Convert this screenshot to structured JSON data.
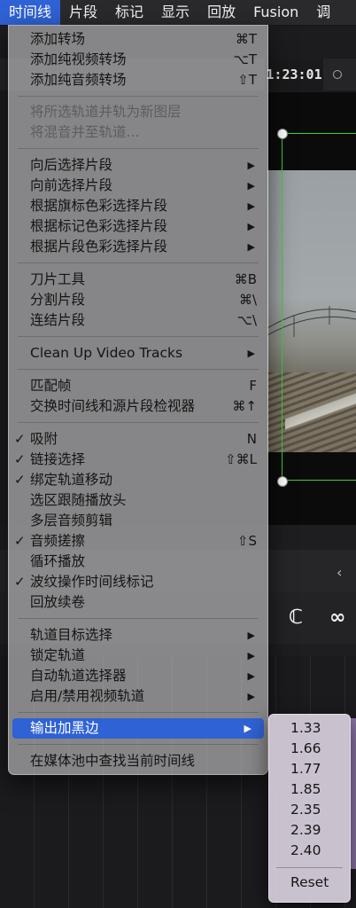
{
  "menubar": {
    "items": [
      "时间线",
      "片段",
      "标记",
      "显示",
      "回放",
      "Fusion",
      "调"
    ]
  },
  "viewer": {
    "timecode": "1:23:01"
  },
  "timeline_menu": {
    "items": [
      {
        "label": "添加转场",
        "shortcut": "⌘T"
      },
      {
        "label": "添加纯视频转场",
        "shortcut": "⌥T"
      },
      {
        "label": "添加纯音频转场",
        "shortcut": "⇧T"
      },
      {
        "label": "将所选轨道并轨为新图层",
        "shortcut": ""
      },
      {
        "label": "将混音并至轨道...",
        "shortcut": ""
      },
      {
        "label": "向后选择片段",
        "shortcut": ""
      },
      {
        "label": "向前选择片段",
        "shortcut": ""
      },
      {
        "label": "根据旗标色彩选择片段",
        "shortcut": ""
      },
      {
        "label": "根据标记色彩选择片段",
        "shortcut": ""
      },
      {
        "label": "根据片段色彩选择片段",
        "shortcut": ""
      },
      {
        "label": "刀片工具",
        "shortcut": "⌘B"
      },
      {
        "label": "分割片段",
        "shortcut": "⌘\\"
      },
      {
        "label": "连结片段",
        "shortcut": "⌥\\"
      },
      {
        "label": "Clean Up Video Tracks",
        "shortcut": ""
      },
      {
        "label": "匹配帧",
        "shortcut": "F"
      },
      {
        "label": "交换时间线和源片段检视器",
        "shortcut": "⌘↑"
      },
      {
        "label": "吸附",
        "shortcut": "N"
      },
      {
        "label": "链接选择",
        "shortcut": "⇧⌘L"
      },
      {
        "label": "绑定轨道移动",
        "shortcut": ""
      },
      {
        "label": "选区跟随播放头",
        "shortcut": ""
      },
      {
        "label": "多层音频剪辑",
        "shortcut": ""
      },
      {
        "label": "音频搓擦",
        "shortcut": "⇧S"
      },
      {
        "label": "循环播放",
        "shortcut": ""
      },
      {
        "label": "波纹操作时间线标记",
        "shortcut": ""
      },
      {
        "label": "回放续卷",
        "shortcut": ""
      },
      {
        "label": "轨道目标选择",
        "shortcut": ""
      },
      {
        "label": "锁定轨道",
        "shortcut": ""
      },
      {
        "label": "自动轨道选择器",
        "shortcut": ""
      },
      {
        "label": "启用/禁用视频轨道",
        "shortcut": ""
      },
      {
        "label": "输出加黑边",
        "shortcut": ""
      },
      {
        "label": "在媒体池中查找当前时间线",
        "shortcut": ""
      }
    ],
    "checkmark": "✓",
    "submenu_arrow": "▶"
  },
  "output_blanking_submenu": {
    "items": [
      "1.33",
      "1.66",
      "1.77",
      "1.85",
      "2.35",
      "2.39",
      "2.40"
    ],
    "reset_label": "Reset"
  },
  "colors": {
    "highlight": "#2f62d4",
    "selection_box": "#3ad33a"
  }
}
